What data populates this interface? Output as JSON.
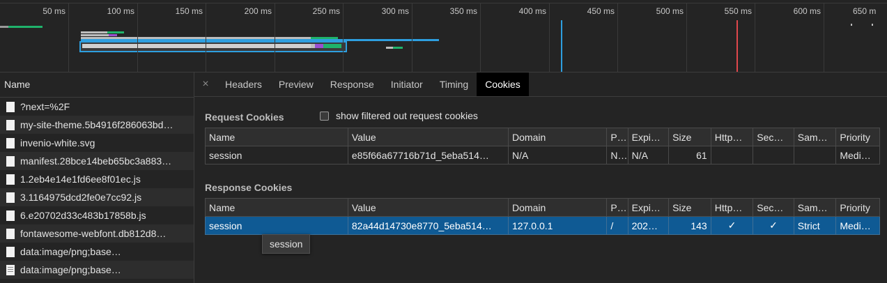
{
  "timeline": {
    "ticks": [
      "50 ms",
      "100 ms",
      "150 ms",
      "200 ms",
      "250 ms",
      "300 ms",
      "350 ms",
      "400 ms",
      "450 ms",
      "500 ms",
      "550 ms",
      "600 ms",
      "650 m"
    ]
  },
  "requests_panel": {
    "header": "Name",
    "items": [
      {
        "label": "?next=%2F"
      },
      {
        "label": "my-site-theme.5b4916f286063bd…"
      },
      {
        "label": "invenio-white.svg"
      },
      {
        "label": "manifest.28bce14beb65bc3a883…"
      },
      {
        "label": "1.2eb4e14e1fd6ee8f01ec.js"
      },
      {
        "label": "3.1164975dcd2fe0e7cc92.js"
      },
      {
        "label": "6.e20702d33c483b17858b.js"
      },
      {
        "label": "fontawesome-webfont.db812d8…"
      },
      {
        "label": "data:image/png;base…"
      },
      {
        "label": "data:image/png;base…"
      }
    ]
  },
  "tabs": {
    "close": "×",
    "items": [
      "Headers",
      "Preview",
      "Response",
      "Initiator",
      "Timing",
      "Cookies"
    ],
    "active": "Cookies"
  },
  "request_cookies": {
    "title": "Request Cookies",
    "filter_label": "show filtered out request cookies",
    "columns": [
      "Name",
      "Value",
      "Domain",
      "P…",
      "Expi…",
      "Size",
      "Http…",
      "Sec…",
      "Sam…",
      "Priority"
    ],
    "rows": [
      [
        "session",
        "e85f66a67716b71d_5eba514…",
        "N/A",
        "N…",
        "N/A",
        "61",
        "",
        "",
        "",
        "Medi…"
      ]
    ]
  },
  "response_cookies": {
    "title": "Response Cookies",
    "columns": [
      "Name",
      "Value",
      "Domain",
      "P…",
      "Expi…",
      "Size",
      "Http…",
      "Sec…",
      "Sam…",
      "Priority"
    ],
    "rows": [
      [
        "session",
        "82a44d14730e8770_5eba514…",
        "127.0.0.1",
        "/",
        "202…",
        "143",
        "✓",
        "✓",
        "Strict",
        "Medi…"
      ]
    ]
  },
  "tooltip": "session"
}
